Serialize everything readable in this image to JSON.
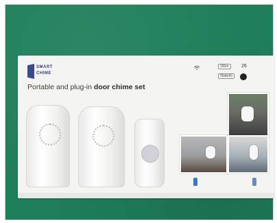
{
  "scene": {
    "background": "#1f7f5a",
    "box_color": "#f4f4f2"
  },
  "brand": {
    "logo_line1": "SMART",
    "logo_line2": "CHIME"
  },
  "product": {
    "headline_prefix": "Portable and plug-in ",
    "headline_emphasis": "door chime set"
  },
  "features": {
    "range": "150m",
    "melodies": "26",
    "volume": "95db(A)"
  },
  "badges": {
    "left": "",
    "right": ""
  },
  "icons": {
    "logo": "brand-mark-icon",
    "wifi": "wifi-icon",
    "disc": "power-icon"
  }
}
